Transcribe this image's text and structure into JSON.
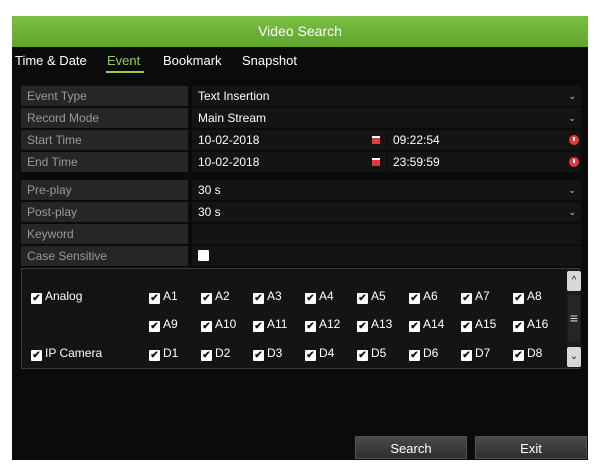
{
  "window": {
    "title": "Video Search"
  },
  "tabs": [
    {
      "label": "Time & Date"
    },
    {
      "label": "Event"
    },
    {
      "label": "Bookmark"
    },
    {
      "label": "Snapshot"
    }
  ],
  "form": {
    "event_type": {
      "label": "Event Type",
      "value": "Text Insertion"
    },
    "record_mode": {
      "label": "Record Mode",
      "value": "Main Stream"
    },
    "start_time": {
      "label": "Start Time",
      "date": "10-02-2018",
      "time": "09:22:54"
    },
    "end_time": {
      "label": "End Time",
      "date": "10-02-2018",
      "time": "23:59:59"
    },
    "pre_play": {
      "label": "Pre-play",
      "value": "30 s"
    },
    "post_play": {
      "label": "Post-play",
      "value": "30 s"
    },
    "keyword": {
      "label": "Keyword",
      "value": ""
    },
    "case_sensitive": {
      "label": "Case Sensitive",
      "checked": false
    }
  },
  "channels": {
    "analog": {
      "label": "Analog",
      "checked": true,
      "items": [
        "A1",
        "A2",
        "A3",
        "A4",
        "A5",
        "A6",
        "A7",
        "A8",
        "A9",
        "A10",
        "A11",
        "A12",
        "A13",
        "A14",
        "A15",
        "A16"
      ]
    },
    "ip_camera": {
      "label": "IP Camera",
      "checked": true,
      "items": [
        "D1",
        "D2",
        "D3",
        "D4",
        "D5",
        "D6",
        "D7",
        "D8"
      ]
    }
  },
  "buttons": {
    "search": "Search",
    "exit": "Exit"
  },
  "icons": {
    "checkmark": "✔",
    "dropdown": "⌄",
    "scroll_up": "^",
    "scroll_down": "⌄",
    "thumb": "≡"
  },
  "colors": {
    "titlebar": "#6bb336",
    "active_tab": "#8fd14f",
    "calendar_icon": "#e23b3b",
    "clock_icon": "#e23b3b"
  }
}
